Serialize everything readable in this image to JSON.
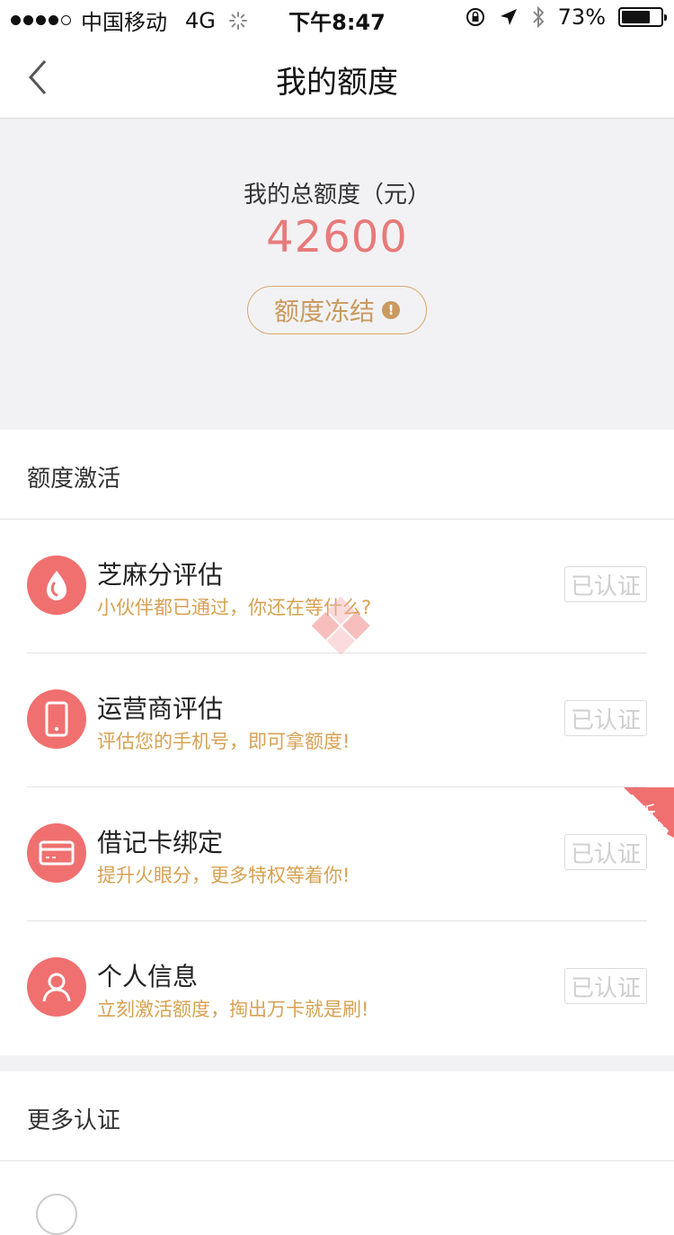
{
  "status_bar": {
    "carrier": "中国移动",
    "network": "4G",
    "time": "下午8:47",
    "battery": "73%",
    "battery_level": 0.73
  },
  "nav": {
    "title": "我的额度"
  },
  "summary": {
    "label": "我的总额度（元）",
    "amount": "42600",
    "freeze_label": "额度冻结",
    "warn_glyph": "!"
  },
  "activation": {
    "header": "额度激活",
    "items": [
      {
        "title": "芝麻分评估",
        "subtitle": "小伙伴都已通过，你还在等什么?",
        "status": "已认证",
        "icon": "sesame-drop-icon"
      },
      {
        "title": "运营商评估",
        "subtitle": "评估您的手机号，即可拿额度!",
        "status": "已认证",
        "icon": "phone-icon"
      },
      {
        "title": "借记卡绑定",
        "subtitle": "提升火眼分，更多特权等着你!",
        "status": "已认证",
        "icon": "bank-card-icon",
        "badge": "新"
      },
      {
        "title": "个人信息",
        "subtitle": "立刻激活额度，掏出万卡就是刷!",
        "status": "已认证",
        "icon": "person-icon"
      }
    ]
  },
  "more": {
    "header": "更多认证"
  },
  "colors": {
    "accent_red": "#f07070",
    "amount_red": "#e87a7a",
    "gold": "#d7a152",
    "background_gray": "#f2f2f5"
  }
}
